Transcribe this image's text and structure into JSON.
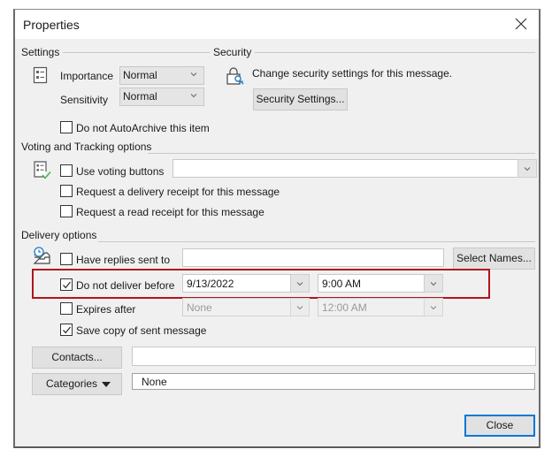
{
  "window": {
    "title": "Properties",
    "close_icon": "close-icon"
  },
  "settings": {
    "group_label": "Settings",
    "icon": "properties-list-icon",
    "importance_label": "Importance",
    "importance_value": "Normal",
    "sensitivity_label": "Sensitivity",
    "sensitivity_value": "Normal",
    "autoarchive_label": "Do not AutoArchive this item",
    "autoarchive_checked": false
  },
  "security": {
    "group_label": "Security",
    "icon": "lock-key-icon",
    "description": "Change security settings for this message.",
    "button_label": "Security Settings..."
  },
  "voting": {
    "group_label": "Voting and Tracking options",
    "icon": "checklist-icon",
    "use_voting_label": "Use voting buttons",
    "use_voting_checked": false,
    "voting_value": "",
    "delivery_receipt_label": "Request a delivery receipt for this message",
    "delivery_receipt_checked": false,
    "read_receipt_label": "Request a read receipt for this message",
    "read_receipt_checked": false
  },
  "delivery": {
    "group_label": "Delivery options",
    "icon": "inbox-clock-icon",
    "replies_label": "Have replies sent to",
    "replies_checked": false,
    "replies_value": "",
    "select_names_label": "Select Names...",
    "deliver_before_label": "Do not deliver before",
    "deliver_before_checked": true,
    "deliver_date": "9/13/2022",
    "deliver_time": "9:00 AM",
    "expires_label": "Expires after",
    "expires_checked": false,
    "expires_date": "None",
    "expires_time": "12:00 AM",
    "save_copy_label": "Save copy of sent message",
    "save_copy_checked": true
  },
  "bottom": {
    "contacts_label": "Contacts...",
    "contacts_value": "",
    "categories_label": "Categories",
    "categories_value": "None",
    "close_label": "Close"
  },
  "colors": {
    "highlight": "#b0151d",
    "accent_blue": "#0078d7",
    "check_green": "#4caf50"
  }
}
